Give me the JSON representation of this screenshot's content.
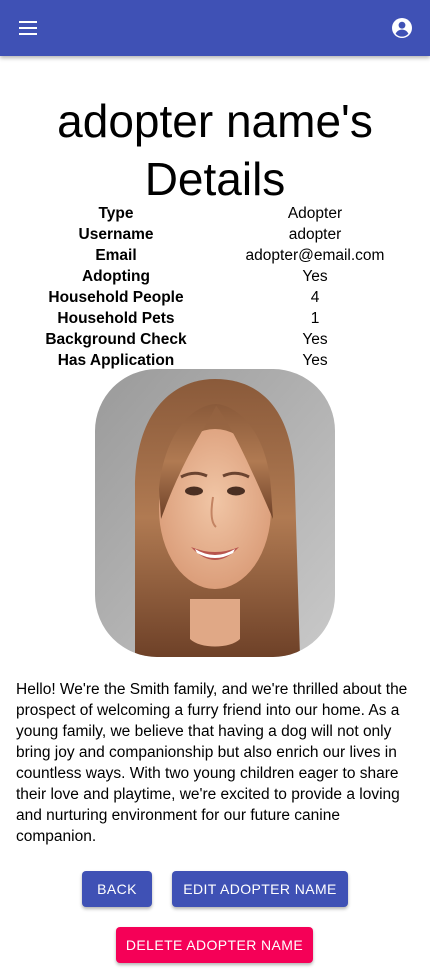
{
  "appbar": {
    "menu_icon": "menu-icon",
    "account_icon": "account-circle-icon",
    "color": "#3f51b5"
  },
  "page": {
    "title": "adopter name's Details"
  },
  "details": [
    {
      "label": "Type",
      "value": "Adopter"
    },
    {
      "label": "Username",
      "value": "adopter"
    },
    {
      "label": "Email",
      "value": "adopter@email.com"
    },
    {
      "label": "Adopting",
      "value": "Yes"
    },
    {
      "label": "Household People",
      "value": "4"
    },
    {
      "label": "Household Pets",
      "value": "1"
    },
    {
      "label": "Background Check",
      "value": "Yes"
    },
    {
      "label": "Has Application",
      "value": "Yes"
    }
  ],
  "bio": "Hello! We're the Smith family, and we're thrilled about the prospect of welcoming a furry friend into our home. As a young family, we believe that having a dog will not only bring joy and companionship but also enrich our lives in countless ways. With two young children eager to share their love and playtime, we're excited to provide a loving and nurturing environment for our future canine companion.",
  "buttons": {
    "back": "BACK",
    "edit": "EDIT ADOPTER NAME",
    "delete": "DELETE ADOPTER NAME"
  },
  "colors": {
    "primary": "#3f51b5",
    "danger": "#f50057"
  }
}
